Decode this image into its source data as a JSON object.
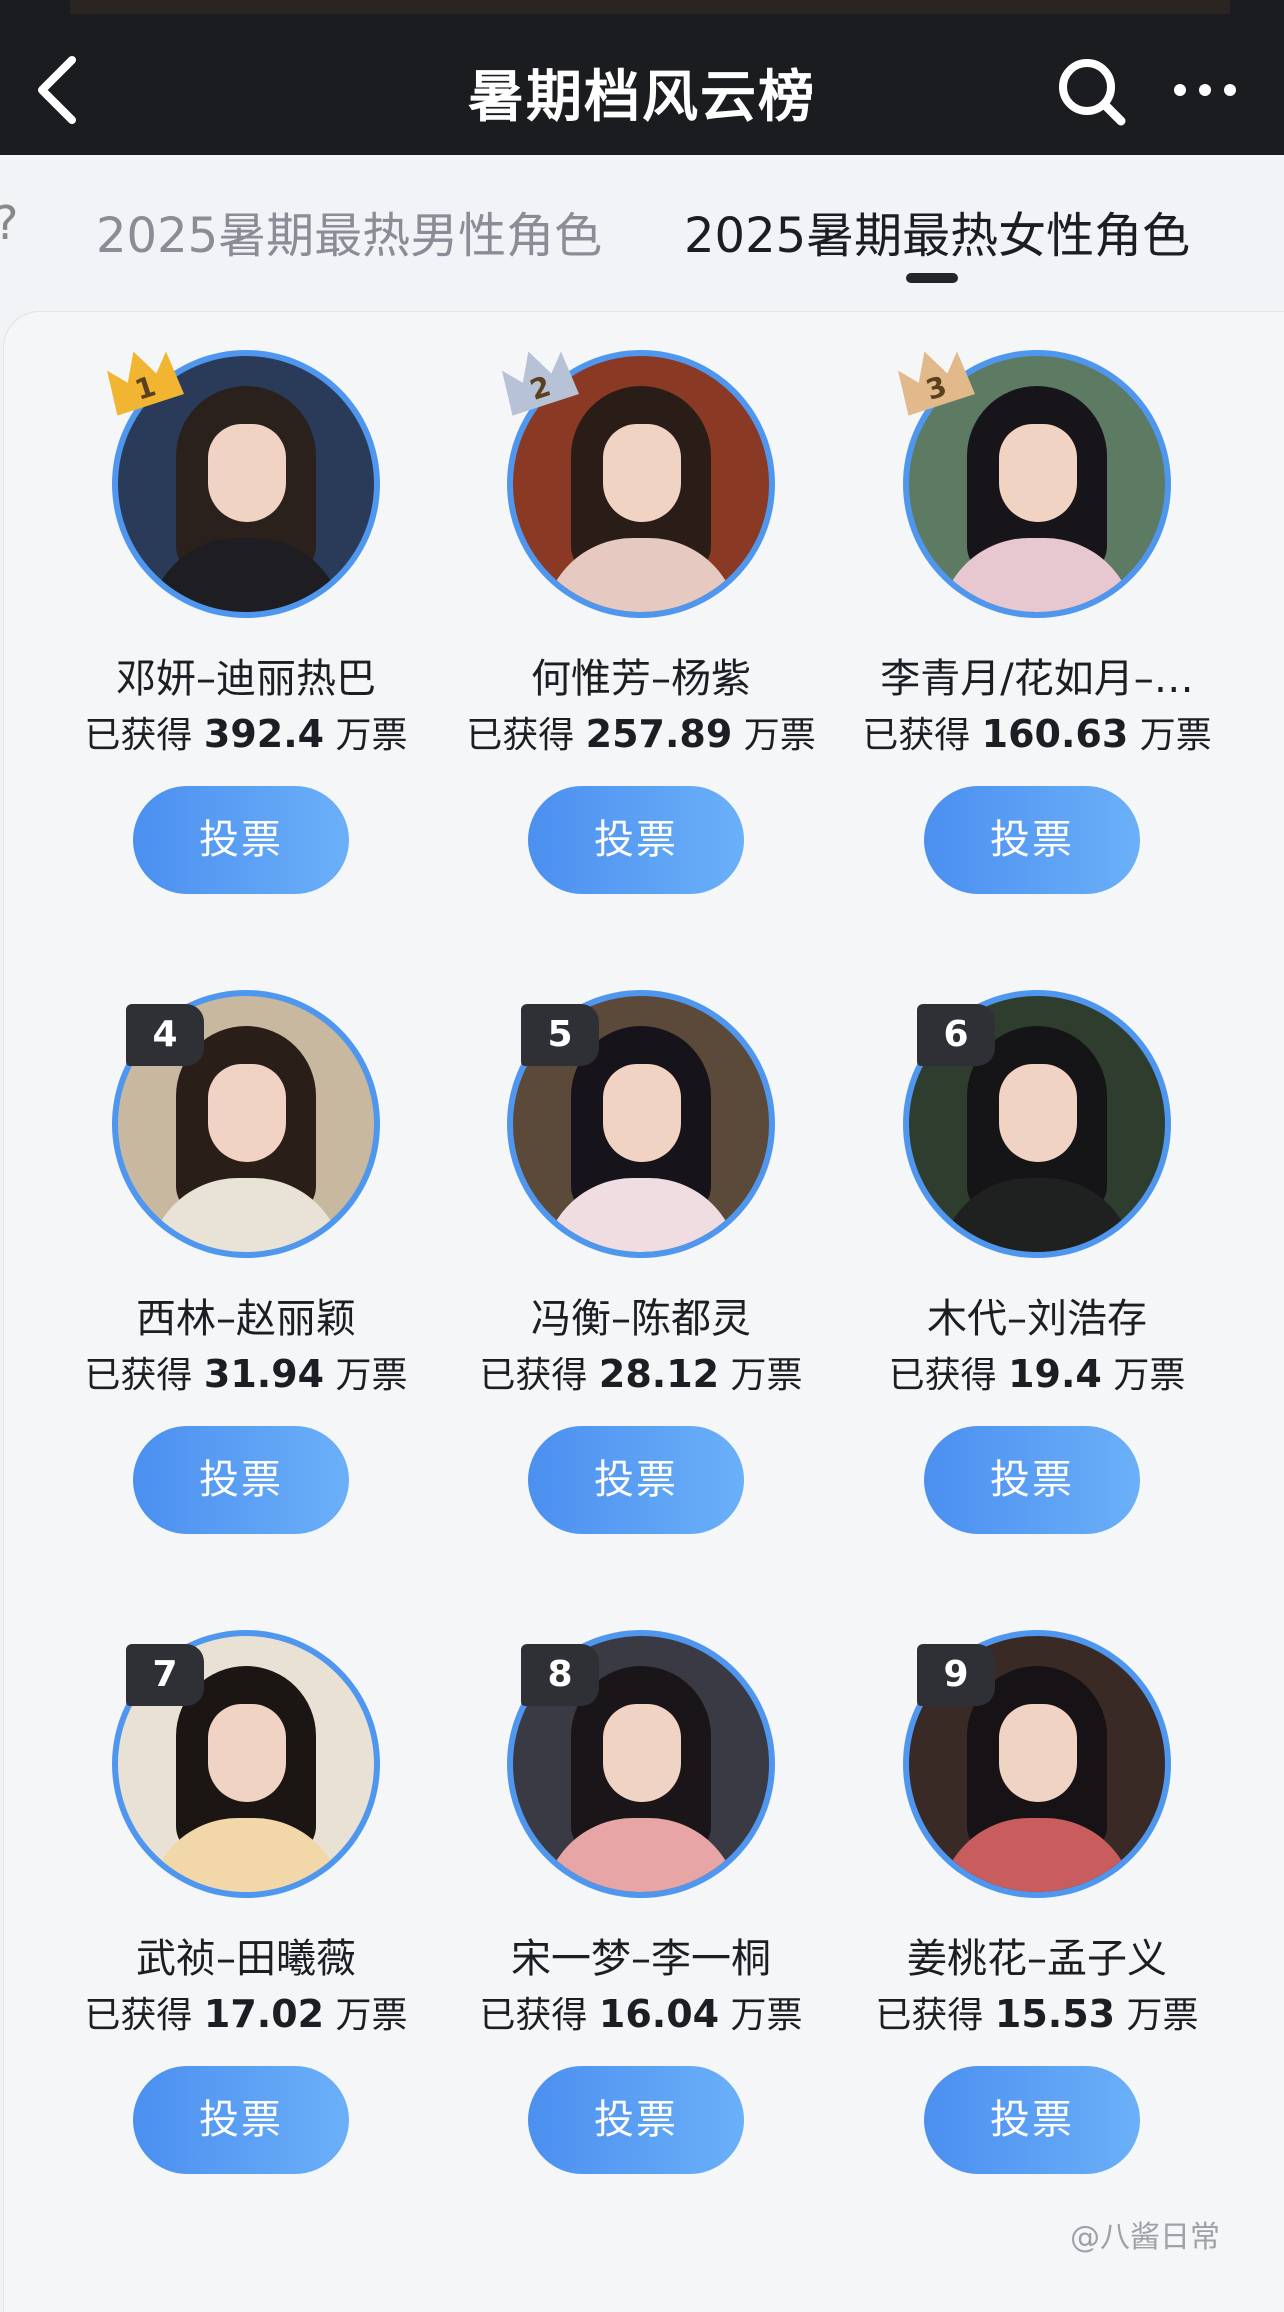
{
  "header": {
    "title": "暑期档风云榜"
  },
  "tabs": [
    {
      "label": "2025暑期最热男性角色",
      "active": false
    },
    {
      "label": "2025暑期最热女性角色",
      "active": true
    }
  ],
  "labels": {
    "vote_prefix": "已获得",
    "vote_suffix": "万票",
    "vote_button": "投票"
  },
  "candidates": [
    {
      "rank": "1",
      "name": "邓妍–迪丽热巴",
      "votes": "392.4",
      "medal_color": "#f2b531"
    },
    {
      "rank": "2",
      "name": "何惟芳–杨紫",
      "votes": "257.89",
      "medal_color": "#b7c2d6"
    },
    {
      "rank": "3",
      "name": "李青月/花如月–…",
      "votes": "160.63",
      "medal_color": "#e2b98b"
    },
    {
      "rank": "4",
      "name": "西林–赵丽颖",
      "votes": "31.94"
    },
    {
      "rank": "5",
      "name": "冯衡–陈都灵",
      "votes": "28.12"
    },
    {
      "rank": "6",
      "name": "木代–刘浩存",
      "votes": "19.4"
    },
    {
      "rank": "7",
      "name": "武祯–田曦薇",
      "votes": "17.02"
    },
    {
      "rank": "8",
      "name": "宋一梦–李一桐",
      "votes": "16.04"
    },
    {
      "rank": "9",
      "name": "姜桃花–孟子义",
      "votes": "15.53"
    }
  ],
  "watermark": "@八酱日常",
  "colors": {
    "header_bg": "#1b1c20",
    "avatar_ring": "#4f97ee",
    "vote_button_start": "#4b8ff0",
    "vote_button_end": "#6bb0f8"
  }
}
